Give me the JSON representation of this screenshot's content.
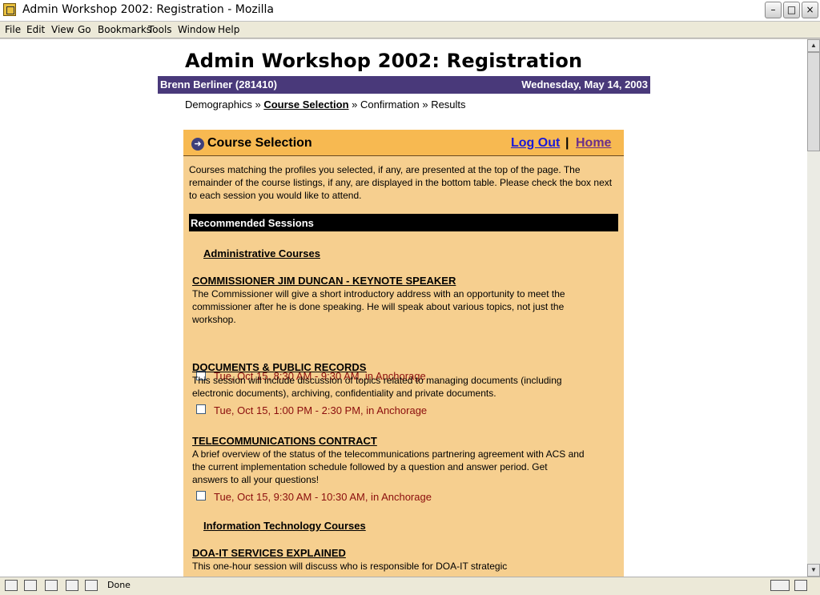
{
  "window": {
    "title": "Admin Workshop 2002: Registration - Mozilla",
    "minimize": "–",
    "maximize": "□",
    "close": "×"
  },
  "menu": [
    "File",
    "Edit",
    "View",
    "Go",
    "Bookmarks",
    "Tools",
    "Window",
    "Help"
  ],
  "status": {
    "text": "Done"
  },
  "page": {
    "heading": "Admin Workshop 2002: Registration",
    "user": "Brenn Berliner (281410)",
    "date": "Wednesday, May 14, 2003",
    "breadcrumb": {
      "step1": "Demographics",
      "sep": "»",
      "step2": "Course Selection",
      "step3": "Confirmation",
      "step4": "Results"
    },
    "panel": {
      "title": "Course Selection",
      "logout": "Log Out",
      "separator": "|",
      "home": "Home",
      "intro": "Courses matching the profiles you selected, if any, are presented at the top of the page. The remainder of the course listings, if any, are displayed in the bottom table. Please check the box next to each session you would like to attend.",
      "recommended": "Recommended Sessions",
      "categories": [
        "Administrative Courses",
        "Information Technology Courses"
      ],
      "courses": [
        {
          "title": "COMMISSIONER JIM DUNCAN - KEYNOTE SPEAKER",
          "description": "The Commissioner will give a short introductory address with an opportunity to meet the commissioner after he is done speaking. He will speak about various topics, not just the workshop.",
          "session": "Tue, Oct 15, 8:30 AM - 9:30 AM, in Anchorage"
        },
        {
          "title": "DOCUMENTS & PUBLIC RECORDS",
          "description": "This session will include discussion of topics related to managing documents (including electronic documents), archiving, confidentiality and private documents.",
          "session": "Tue, Oct 15, 1:00 PM - 2:30 PM, in Anchorage"
        },
        {
          "title": "TELECOMMUNICATIONS CONTRACT",
          "description": "A brief overview of the status of the telecommunications partnering agreement with ACS and the current implementation schedule followed by a question and answer period. Get answers to all your questions!",
          "session": "Tue, Oct 15, 9:30 AM - 10:30 AM, in Anchorage"
        },
        {
          "title": "DOA-IT SERVICES EXPLAINED",
          "description": "This one-hour session will discuss who is responsible for DOA-IT strategic"
        }
      ]
    }
  }
}
